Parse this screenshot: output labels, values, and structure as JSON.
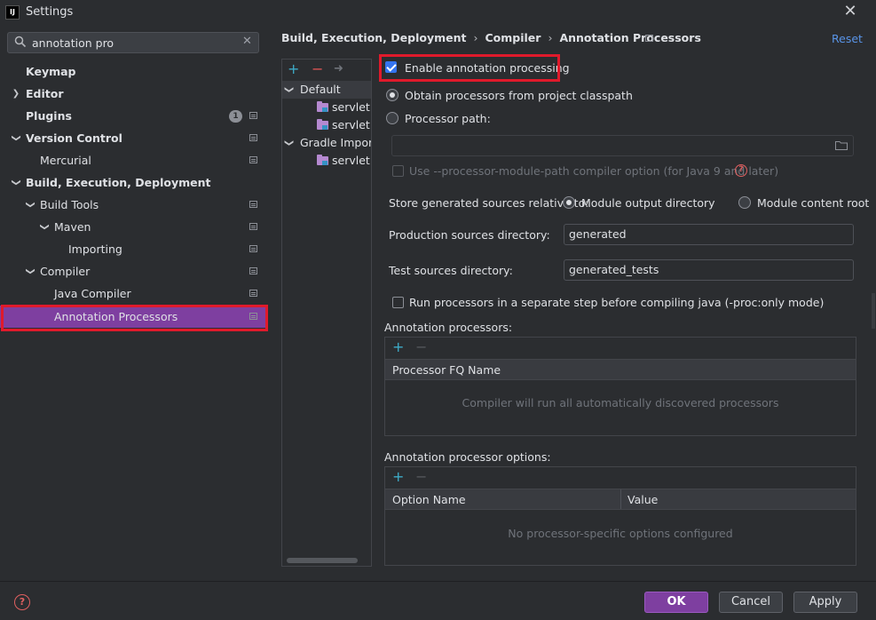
{
  "window": {
    "logo_text": "IJ",
    "title": "Settings",
    "close_glyph": "✕"
  },
  "search": {
    "value": "annotation pro",
    "icon": "search-icon",
    "clear_glyph": "✕"
  },
  "sidebar": {
    "items": [
      {
        "label": "Keymap"
      },
      {
        "label": "Editor"
      },
      {
        "label": "Plugins",
        "badge": "1"
      },
      {
        "label": "Version Control"
      },
      {
        "label": "Mercurial"
      },
      {
        "label": "Build, Execution, Deployment"
      },
      {
        "label": "Build Tools"
      },
      {
        "label": "Maven"
      },
      {
        "label": "Importing"
      },
      {
        "label": "Compiler"
      },
      {
        "label": "Java Compiler"
      },
      {
        "label": "Annotation Processors"
      }
    ],
    "selected": "Annotation Processors"
  },
  "breadcrumb": {
    "items": [
      "Build, Execution, Deployment",
      "Compiler",
      "Annotation Processors"
    ],
    "separator": "›",
    "reset_label": "Reset"
  },
  "profiles": {
    "toolbar": {
      "add": "+",
      "remove": "−",
      "move": "➜"
    },
    "tree": [
      {
        "label": "Default"
      },
      {
        "label": "servlet"
      },
      {
        "label": "servlet.te"
      },
      {
        "label": "Gradle Importe"
      },
      {
        "label": "servlet.m"
      }
    ]
  },
  "form": {
    "enable_processing_label": "Enable annotation processing",
    "enable_processing_checked": true,
    "obtain_from_classpath_label": "Obtain processors from project classpath",
    "processor_path_label": "Processor path:",
    "processor_path_value": "",
    "module_path_option_label": "Use --processor-module-path compiler option (for Java 9 and later)",
    "store_generated_label": "Store generated sources relative to:",
    "module_output_label": "Module output directory",
    "module_content_label": "Module content root",
    "production_dir_label": "Production sources directory:",
    "production_dir_value": "generated",
    "test_dir_label": "Test sources directory:",
    "test_dir_value": "generated_tests",
    "run_separate_label": "Run processors in a separate step before compiling java (-proc:only mode)",
    "help_glyph": "?"
  },
  "annotation_processors": {
    "title": "Annotation processors:",
    "add": "+",
    "remove": "−",
    "columns": [
      "Processor FQ Name"
    ],
    "empty_text": "Compiler will run all automatically discovered processors"
  },
  "processor_options": {
    "title": "Annotation processor options:",
    "add": "+",
    "remove": "−",
    "columns": [
      "Option Name",
      "Value"
    ],
    "empty_text": "No processor-specific options configured"
  },
  "footer": {
    "help_glyph": "?",
    "ok_label": "OK",
    "cancel_label": "Cancel",
    "apply_label": "Apply"
  },
  "colors": {
    "accent": "#7e3fa0",
    "highlight_outline": "#e01a2b",
    "link": "#5994e8",
    "background": "#2b2d30"
  }
}
